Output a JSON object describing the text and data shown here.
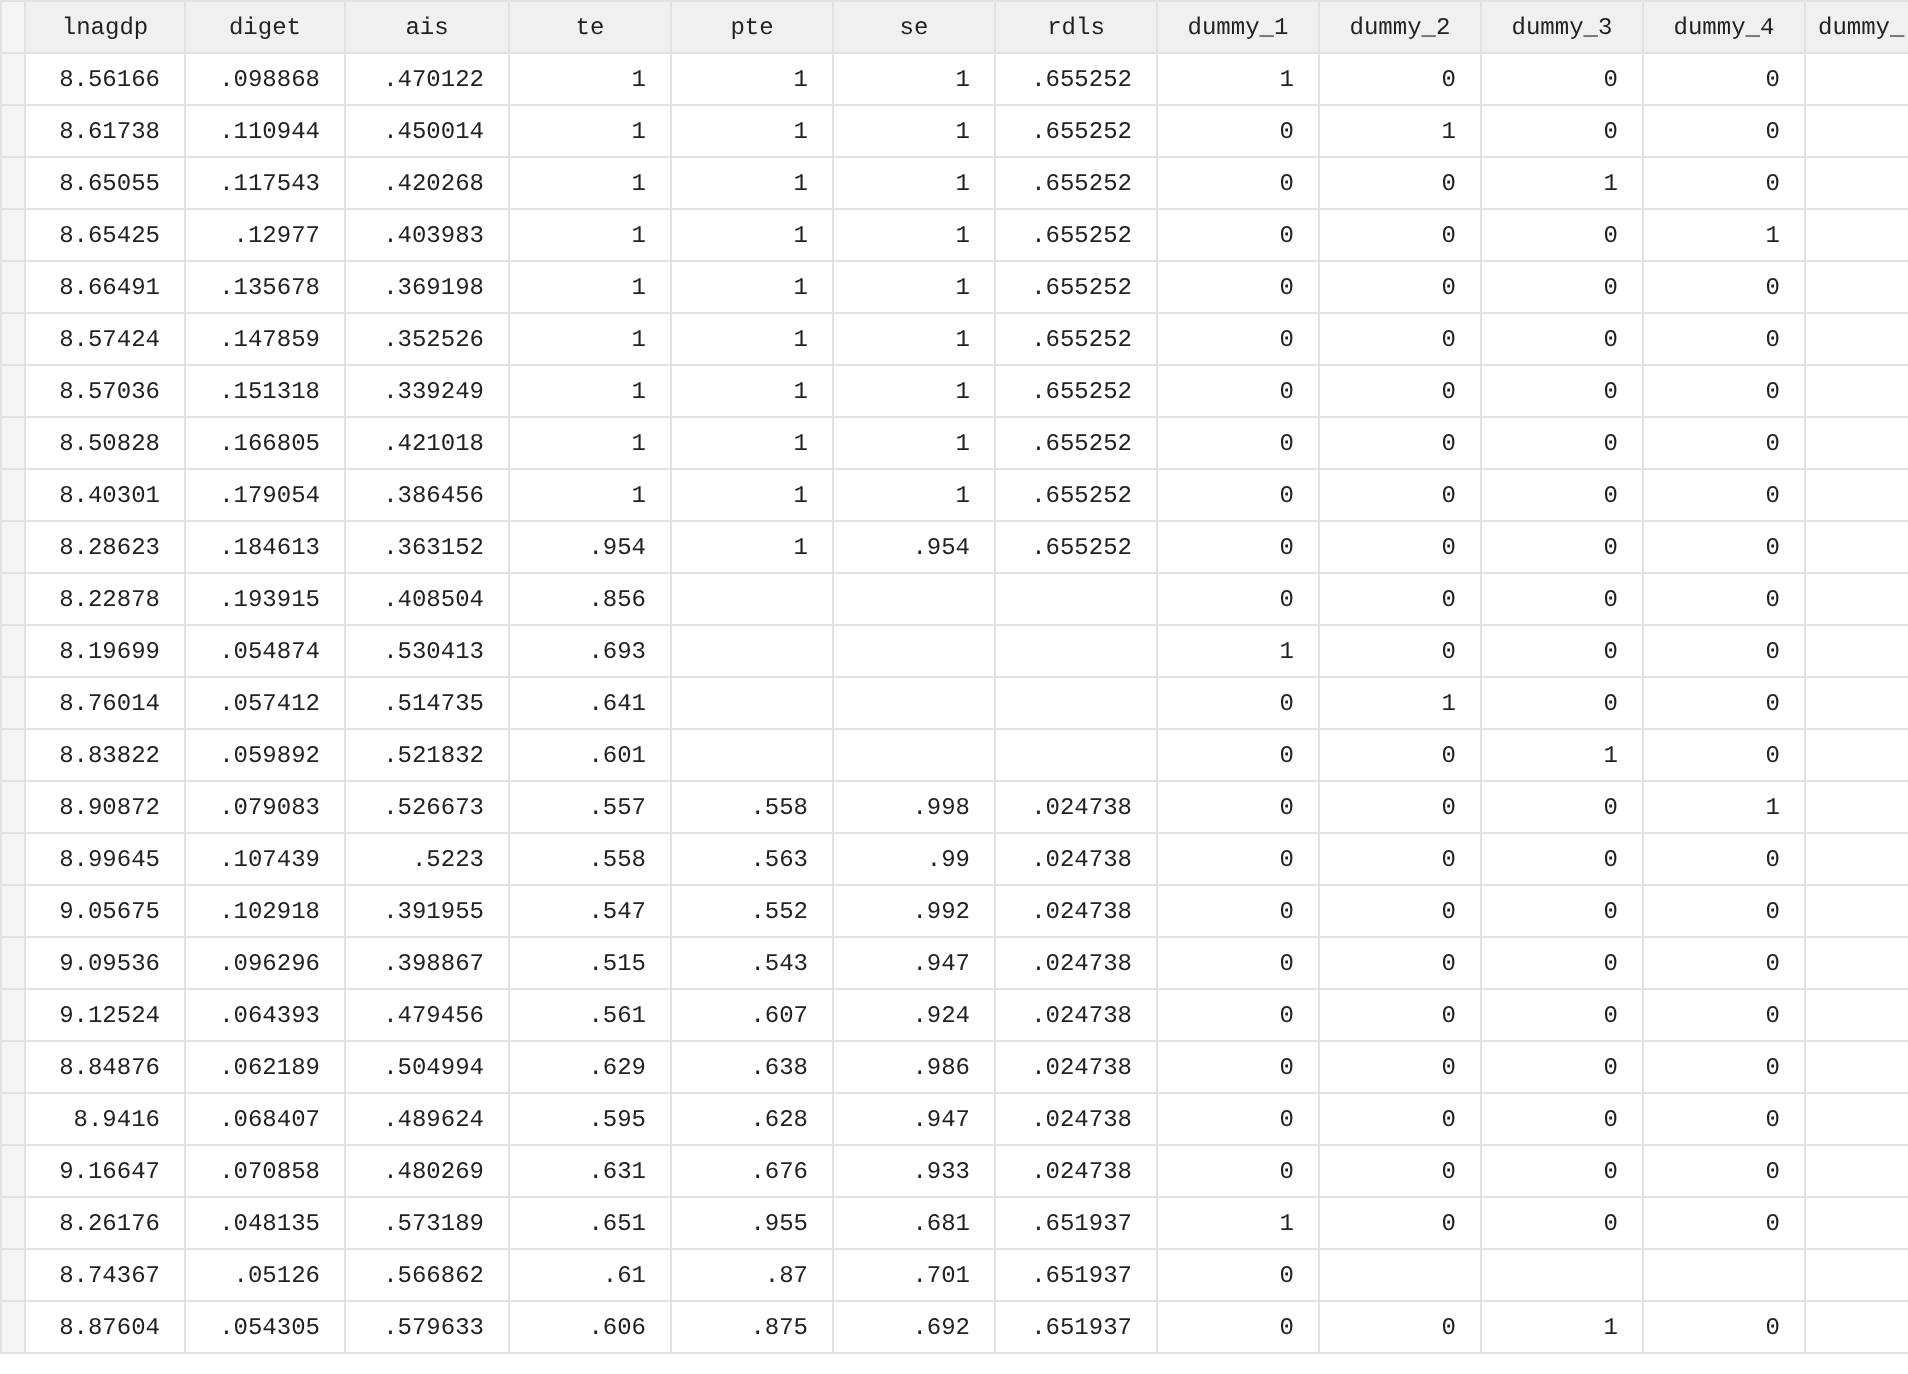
{
  "table": {
    "columns": [
      "lnagdp",
      "diget",
      "ais",
      "te",
      "pte",
      "se",
      "rdls",
      "dummy_1",
      "dummy_2",
      "dummy_3",
      "dummy_4",
      "dummy_"
    ],
    "rows": [
      [
        "8.56166",
        ".098868",
        ".470122",
        "1",
        "1",
        "1",
        ".655252",
        "1",
        "0",
        "0",
        "0"
      ],
      [
        "8.61738",
        ".110944",
        ".450014",
        "1",
        "1",
        "1",
        ".655252",
        "0",
        "1",
        "0",
        "0"
      ],
      [
        "8.65055",
        ".117543",
        ".420268",
        "1",
        "1",
        "1",
        ".655252",
        "0",
        "0",
        "1",
        "0"
      ],
      [
        "8.65425",
        ".12977",
        ".403983",
        "1",
        "1",
        "1",
        ".655252",
        "0",
        "0",
        "0",
        "1"
      ],
      [
        "8.66491",
        ".135678",
        ".369198",
        "1",
        "1",
        "1",
        ".655252",
        "0",
        "0",
        "0",
        "0"
      ],
      [
        "8.57424",
        ".147859",
        ".352526",
        "1",
        "1",
        "1",
        ".655252",
        "0",
        "0",
        "0",
        "0"
      ],
      [
        "8.57036",
        ".151318",
        ".339249",
        "1",
        "1",
        "1",
        ".655252",
        "0",
        "0",
        "0",
        "0"
      ],
      [
        "8.50828",
        ".166805",
        ".421018",
        "1",
        "1",
        "1",
        ".655252",
        "0",
        "0",
        "0",
        "0"
      ],
      [
        "8.40301",
        ".179054",
        ".386456",
        "1",
        "1",
        "1",
        ".655252",
        "0",
        "0",
        "0",
        "0"
      ],
      [
        "8.28623",
        ".184613",
        ".363152",
        ".954",
        "1",
        ".954",
        ".655252",
        "0",
        "0",
        "0",
        "0"
      ],
      [
        "8.22878",
        ".193915",
        ".408504",
        ".856",
        null,
        null,
        null,
        "0",
        "0",
        "0",
        "0"
      ],
      [
        "8.19699",
        ".054874",
        ".530413",
        ".693",
        null,
        null,
        null,
        "1",
        "0",
        "0",
        "0"
      ],
      [
        "8.76014",
        ".057412",
        ".514735",
        ".641",
        null,
        null,
        null,
        "0",
        "1",
        "0",
        "0"
      ],
      [
        "8.83822",
        ".059892",
        ".521832",
        ".601",
        null,
        null,
        null,
        "0",
        "0",
        "1",
        "0"
      ],
      [
        "8.90872",
        ".079083",
        ".526673",
        ".557",
        ".558",
        ".998",
        ".024738",
        "0",
        "0",
        "0",
        "1"
      ],
      [
        "8.99645",
        ".107439",
        ".5223",
        ".558",
        ".563",
        ".99",
        ".024738",
        "0",
        "0",
        "0",
        "0"
      ],
      [
        "9.05675",
        ".102918",
        ".391955",
        ".547",
        ".552",
        ".992",
        ".024738",
        "0",
        "0",
        "0",
        "0"
      ],
      [
        "9.09536",
        ".096296",
        ".398867",
        ".515",
        ".543",
        ".947",
        ".024738",
        "0",
        "0",
        "0",
        "0"
      ],
      [
        "9.12524",
        ".064393",
        ".479456",
        ".561",
        ".607",
        ".924",
        ".024738",
        "0",
        "0",
        "0",
        "0"
      ],
      [
        "8.84876",
        ".062189",
        ".504994",
        ".629",
        ".638",
        ".986",
        ".024738",
        "0",
        "0",
        "0",
        "0"
      ],
      [
        "8.9416",
        ".068407",
        ".489624",
        ".595",
        ".628",
        ".947",
        ".024738",
        "0",
        "0",
        "0",
        "0"
      ],
      [
        "9.16647",
        ".070858",
        ".480269",
        ".631",
        ".676",
        ".933",
        ".024738",
        "0",
        "0",
        "0",
        "0"
      ],
      [
        "8.26176",
        ".048135",
        ".573189",
        ".651",
        ".955",
        ".681",
        ".651937",
        "1",
        "0",
        "0",
        "0"
      ],
      [
        "8.74367",
        ".05126",
        ".566862",
        ".61",
        ".87",
        ".701",
        ".651937",
        "0",
        null,
        null,
        null
      ],
      [
        "8.87604",
        ".054305",
        ".579633",
        ".606",
        ".875",
        ".692",
        ".651937",
        "0",
        "0",
        "1",
        "0"
      ]
    ]
  }
}
